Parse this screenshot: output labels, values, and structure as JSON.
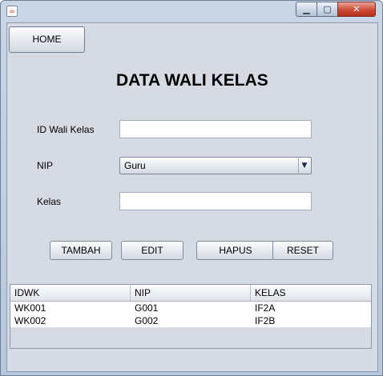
{
  "window": {
    "title": "",
    "app_icon": "java-cup-icon",
    "controls": {
      "minimize": "▁",
      "maximize": "▢",
      "close": "✕"
    }
  },
  "nav": {
    "home_label": "HOME"
  },
  "heading": "DATA WALI KELAS",
  "form": {
    "id_label": "ID Wali Kelas",
    "id_value": "",
    "nip_label": "NIP",
    "nip_selected": "Guru",
    "kelas_label": "Kelas",
    "kelas_value": ""
  },
  "actions": {
    "tambah": "TAMBAH",
    "edit": "EDIT",
    "hapus": "HAPUS",
    "reset": "RESET"
  },
  "table": {
    "columns": [
      "IDWK",
      "NIP",
      "KELAS"
    ],
    "rows": [
      [
        "WK001",
        "G001",
        "IF2A"
      ],
      [
        "WK002",
        "G002",
        "IF2B"
      ]
    ]
  },
  "colors": {
    "panel": "#d6dae2",
    "close_button": "#cc4b36"
  }
}
